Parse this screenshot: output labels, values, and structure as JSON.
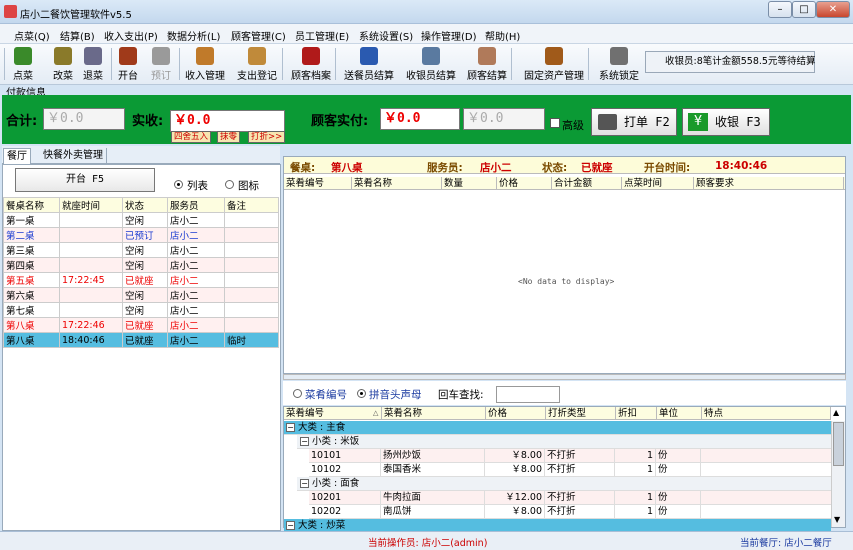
{
  "app": {
    "title": "店小二餐饮管理软件v5.5"
  },
  "menu": [
    "点菜(Q)",
    "结算(B)",
    "收入支出(P)",
    "数据分析(L)",
    "顾客管理(C)",
    "员工管理(E)",
    "系统设置(S)",
    "操作管理(D)",
    "帮助(H)"
  ],
  "toolbar": [
    {
      "label": "点菜",
      "icon": "order-icon",
      "color": "#3a8a2a"
    },
    {
      "label": "改菜",
      "icon": "edit-dish-icon",
      "color": "#8a7a2a"
    },
    {
      "label": "退菜",
      "icon": "return-dish-icon",
      "color": "#6a6a8a"
    },
    {
      "label": "开台",
      "icon": "open-table-icon",
      "color": "#a03a1a"
    },
    {
      "label": "预订",
      "icon": "reserve-icon",
      "color": "#9a9a9a"
    },
    {
      "label": "收入管理",
      "icon": "income-icon",
      "color": "#c07a2a"
    },
    {
      "label": "支出登记",
      "icon": "expense-icon",
      "color": "#c08a3a"
    },
    {
      "label": "顾客档案",
      "icon": "customer-file-icon",
      "color": "#b01a1a"
    },
    {
      "label": "送餐员结算",
      "icon": "delivery-settle-icon",
      "color": "#2a5ab0"
    },
    {
      "label": "收银员结算",
      "icon": "cashier-settle-icon",
      "color": "#5a7aa0"
    },
    {
      "label": "顾客结算",
      "icon": "customer-settle-icon",
      "color": "#b07a5a"
    },
    {
      "label": "固定资产管理",
      "icon": "fixed-asset-icon",
      "color": "#a05a1a"
    },
    {
      "label": "系统锁定",
      "icon": "lock-icon",
      "color": "#707070"
    }
  ],
  "notice": "收银员:8笔计金额558.5元等待结算",
  "payment": {
    "section_label": "付款信息",
    "total_label": "合计:",
    "total": "￥0.0",
    "actual_label": "实收:",
    "actual": "￥0.0",
    "round_btn": "四舍五入",
    "zero_btn": "抹零",
    "discount_btn": "打折>>",
    "paid_label": "顾客实付:",
    "paid": "￥0.0",
    "change": "￥0.0",
    "advanced": "高级",
    "print_btn": "打单 F2",
    "cash_btn": "收银 F3"
  },
  "left": {
    "tabs": [
      "餐厅",
      "快餐外卖管理"
    ],
    "open_btn": "开台 F5",
    "view_list": "列表",
    "view_icon": "图标",
    "columns": [
      "餐桌名称",
      "就座时间",
      "状态",
      "服务员",
      "备注"
    ],
    "rows": [
      {
        "name": "第一桌",
        "time": "",
        "status": "空闲",
        "waiter": "店小二",
        "note": "",
        "style": "normal"
      },
      {
        "name": "第二桌",
        "time": "",
        "status": "已预订",
        "waiter": "店小二",
        "note": "",
        "style": "blue"
      },
      {
        "name": "第三桌",
        "time": "",
        "status": "空闲",
        "waiter": "店小二",
        "note": "",
        "style": "normal"
      },
      {
        "name": "第四桌",
        "time": "",
        "status": "空闲",
        "waiter": "店小二",
        "note": "",
        "style": "normal"
      },
      {
        "name": "第五桌",
        "time": "17:22:45",
        "status": "已就座",
        "waiter": "店小二",
        "note": "",
        "style": "red"
      },
      {
        "name": "第六桌",
        "time": "",
        "status": "空闲",
        "waiter": "店小二",
        "note": "",
        "style": "normal"
      },
      {
        "name": "第七桌",
        "time": "",
        "status": "空闲",
        "waiter": "店小二",
        "note": "",
        "style": "normal"
      },
      {
        "name": "第八桌",
        "time": "17:22:46",
        "status": "已就座",
        "waiter": "店小二",
        "note": "",
        "style": "red"
      },
      {
        "name": "第八桌",
        "time": "18:40:46",
        "status": "已就座",
        "waiter": "店小二",
        "note": "临时",
        "style": "selected"
      }
    ]
  },
  "order": {
    "table_label": "餐桌:",
    "table": "第八桌",
    "waiter_label": "服务员:",
    "waiter": "店小二",
    "status_label": "状态:",
    "status": "已就座",
    "time_label": "开台时间:",
    "time": "18:40:46",
    "columns": [
      "菜肴编号",
      "菜肴名称",
      "数量",
      "价格",
      "合计金额",
      "点菜时间",
      "顾客要求"
    ],
    "empty": "<No data to display>"
  },
  "search": {
    "by_code": "菜肴编号",
    "by_pinyin": "拼音头声母",
    "enter_label": "回车查找:",
    "value": ""
  },
  "dishes": {
    "columns": [
      "菜肴编号",
      "菜肴名称",
      "价格",
      "打折类型",
      "折扣",
      "单位",
      "特点"
    ],
    "groups": [
      {
        "label": "大类 : 主食",
        "sub": [
          {
            "label": "小类 : 米饭",
            "items": [
              {
                "code": "10101",
                "name": "扬州炒饭",
                "price": "￥8.00",
                "type": "不打折",
                "discount": "1",
                "unit": "份"
              },
              {
                "code": "10102",
                "name": "泰国香米",
                "price": "￥8.00",
                "type": "不打折",
                "discount": "1",
                "unit": "份"
              }
            ]
          },
          {
            "label": "小类 : 面食",
            "items": [
              {
                "code": "10201",
                "name": "牛肉拉面",
                "price": "￥12.00",
                "type": "不打折",
                "discount": "1",
                "unit": "份"
              },
              {
                "code": "10202",
                "name": "南瓜饼",
                "price": "￥8.00",
                "type": "不打折",
                "discount": "1",
                "unit": "份"
              }
            ]
          }
        ]
      },
      {
        "label": "大类 : 炒菜",
        "sub": []
      }
    ]
  },
  "status": {
    "operator": "当前操作员: 店小二(admin)",
    "restaurant": "当前餐厅: 店小二餐厅"
  }
}
